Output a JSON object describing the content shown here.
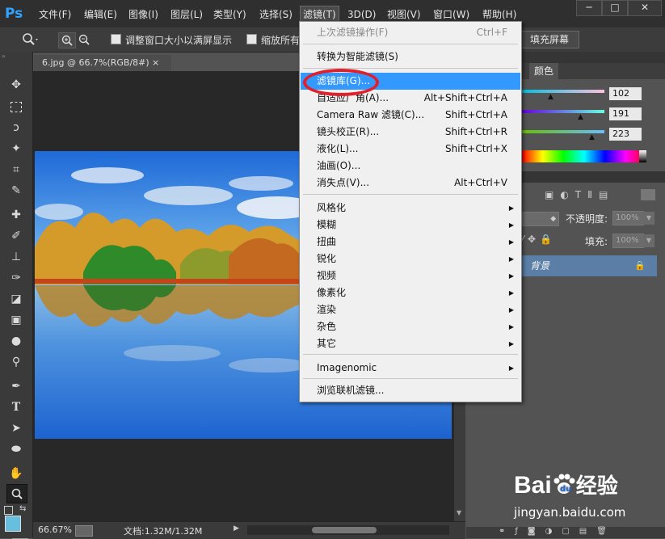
{
  "app": {
    "logo": "Ps",
    "menus": [
      "文件(F)",
      "编辑(E)",
      "图像(I)",
      "图层(L)",
      "类型(Y)",
      "选择(S)",
      "滤镜(T)",
      "3D(D)",
      "视图(V)",
      "窗口(W)",
      "帮助(H)"
    ],
    "active_menu": "滤镜(T)",
    "window_controls": [
      "─",
      "□",
      "✕"
    ]
  },
  "options_bar": {
    "resize_label": "调整窗口大小以满屏显示",
    "zoom_all_label": "缩放所有",
    "fill_screen_label": "填充屏幕"
  },
  "document": {
    "tab_label": "6.jpg @ 66.7%(RGB/8#)",
    "close_icon": "×"
  },
  "status_bar": {
    "zoom": "66.67%",
    "doc_info": "文档:1.32M/1.32M"
  },
  "color_panel": {
    "tab_label": "颜色",
    "r": "102",
    "g": "191",
    "b": "223"
  },
  "layers_panel": {
    "opacity_label": "不透明度:",
    "opacity_value": "100%",
    "fill_label": "填充:",
    "fill_value": "100%",
    "layer_name": "背景"
  },
  "filter_menu": {
    "items": [
      {
        "label": "上次滤镜操作(F)",
        "shortcut": "Ctrl+F",
        "disabled": true
      },
      {
        "sep": true
      },
      {
        "label": "转换为智能滤镜(S)",
        "shortcut": ""
      },
      {
        "sep": true
      },
      {
        "label": "滤镜库(G)...",
        "shortcut": "",
        "highlight": true
      },
      {
        "label": "自适应广角(A)...",
        "shortcut": "Alt+Shift+Ctrl+A"
      },
      {
        "label": "Camera Raw 滤镜(C)...",
        "shortcut": "Shift+Ctrl+A"
      },
      {
        "label": "镜头校正(R)...",
        "shortcut": "Shift+Ctrl+R"
      },
      {
        "label": "液化(L)...",
        "shortcut": "Shift+Ctrl+X"
      },
      {
        "label": "油画(O)...",
        "shortcut": ""
      },
      {
        "label": "消失点(V)...",
        "shortcut": "Alt+Ctrl+V"
      },
      {
        "sep": true
      },
      {
        "label": "风格化",
        "submenu": true
      },
      {
        "label": "模糊",
        "submenu": true
      },
      {
        "label": "扭曲",
        "submenu": true
      },
      {
        "label": "锐化",
        "submenu": true
      },
      {
        "label": "视频",
        "submenu": true
      },
      {
        "label": "像素化",
        "submenu": true
      },
      {
        "label": "渲染",
        "submenu": true
      },
      {
        "label": "杂色",
        "submenu": true
      },
      {
        "label": "其它",
        "submenu": true
      },
      {
        "sep": true
      },
      {
        "label": "Imagenomic",
        "submenu": true
      },
      {
        "sep": true
      },
      {
        "label": "浏览联机滤镜..."
      }
    ]
  },
  "watermark": {
    "brand_left": "Bai",
    "brand_right": "经验",
    "url": "jingyan.baidu.com"
  },
  "colors": {
    "accent_highlight": "#3399ff",
    "annotation_red": "#e0202a",
    "selected_layer": "#5a7ea6",
    "ps_blue": "#2fa3ff",
    "swatch_fg": "#66bfdf"
  }
}
